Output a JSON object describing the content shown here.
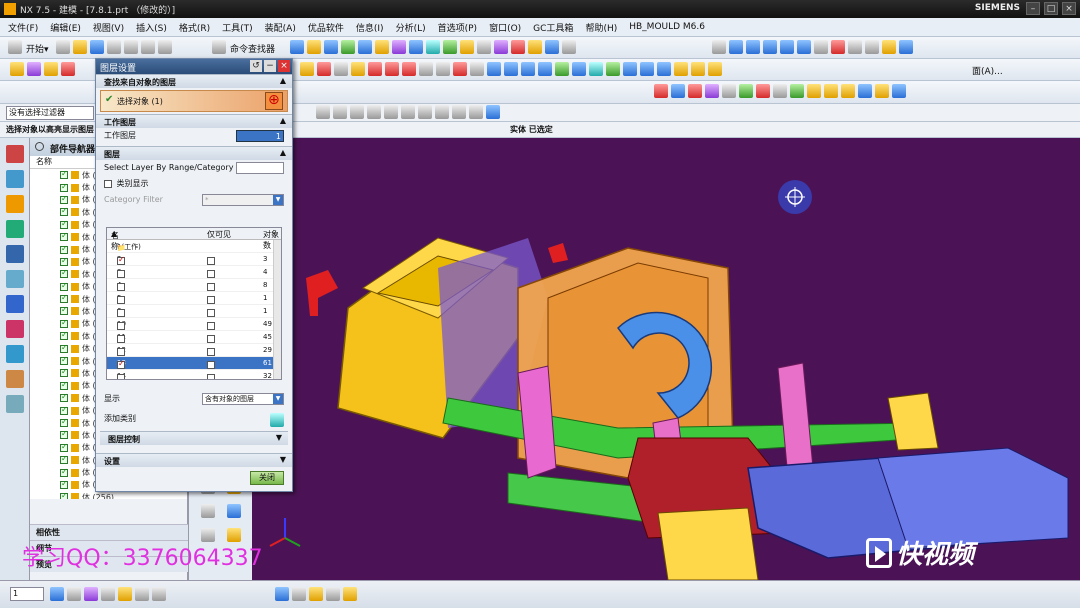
{
  "titlebar": {
    "title": "NX 7.5 - 建模 - [7.8.1.prt （修改的）]",
    "brand": "SIEMENS",
    "min": "–",
    "max": "□",
    "close": "×"
  },
  "menu": [
    "文件(F)",
    "编辑(E)",
    "视图(V)",
    "插入(S)",
    "格式(R)",
    "工具(T)",
    "装配(A)",
    "优品软件",
    "信息(I)",
    "分析(L)",
    "首选项(P)",
    "窗口(O)",
    "GC工具箱",
    "帮助(H)",
    "HB_MOULD M6.6"
  ],
  "toolbar": {
    "start": "开始▾",
    "command_finder": "命令查找器",
    "face_label": "面(A)..."
  },
  "filter": {
    "value": "没有选择过滤器"
  },
  "prompt": "选择对象以高亮显示图层",
  "status": "实体 已选定",
  "navigator": {
    "title": "部件导航器",
    "col_name": "名称",
    "rows": [
      "体 (",
      "体 (",
      "体 (",
      "体 (",
      "体 (",
      "体 (",
      "体 (",
      "体 (",
      "体 (",
      "体 (",
      "体 (",
      "体 (",
      "体 (",
      "体 (",
      "体 (",
      "体 (",
      "体 (",
      "体 (",
      "体 (",
      "体 (",
      "体 (",
      "体 (",
      "体 (",
      "体 (",
      "体 (",
      "体 (255)",
      "体 (256)"
    ],
    "dependencies": "相依性",
    "details": "细节",
    "preview": "预览"
  },
  "dialog": {
    "title": "图层设置",
    "sect_find": "查找来自对象的图层",
    "select_object": "选择对象 (1)",
    "sect_work": "工作图层",
    "work_label": "工作图层",
    "work_value": "1",
    "sect_layers": "图层",
    "range_label": "Select Layer By Range/Category",
    "show_category": "类别显示",
    "category_filter": "Category Filter",
    "category_value": "*",
    "table_headers": [
      "名称",
      "仅可见",
      "对象数"
    ],
    "table_rows": [
      {
        "name": "1(工作)",
        "visible": "",
        "count": "",
        "checked": false
      },
      {
        "name": "2",
        "visible": "",
        "count": "3",
        "checked": true
      },
      {
        "name": "3",
        "visible": "",
        "count": "4",
        "checked": false
      },
      {
        "name": "4",
        "visible": "",
        "count": "8",
        "checked": false
      },
      {
        "name": "5",
        "visible": "",
        "count": "1",
        "checked": false
      },
      {
        "name": "6",
        "visible": "",
        "count": "1",
        "checked": false
      },
      {
        "name": "10",
        "visible": "",
        "count": "49",
        "checked": false
      },
      {
        "name": "11",
        "visible": "",
        "count": "45",
        "checked": false
      },
      {
        "name": "12",
        "visible": "",
        "count": "29",
        "checked": false
      },
      {
        "name": "13",
        "visible": "",
        "count": "61",
        "checked": true
      },
      {
        "name": "14",
        "visible": "",
        "count": "32",
        "checked": false
      }
    ],
    "display_label": "显示",
    "display_value": "含有对象的图层",
    "add_category": "添加类别",
    "sect_layer_ctrl": "图层控制",
    "sect_settings": "设置",
    "close_btn": "关闭"
  },
  "bottombar": {
    "layer_value": "1"
  },
  "watermark": {
    "qq": "学习QQ：3376064337",
    "brand": "快视频"
  },
  "colors": {
    "viewport_bg": "#4b1356",
    "accent": "#3b73c5"
  }
}
